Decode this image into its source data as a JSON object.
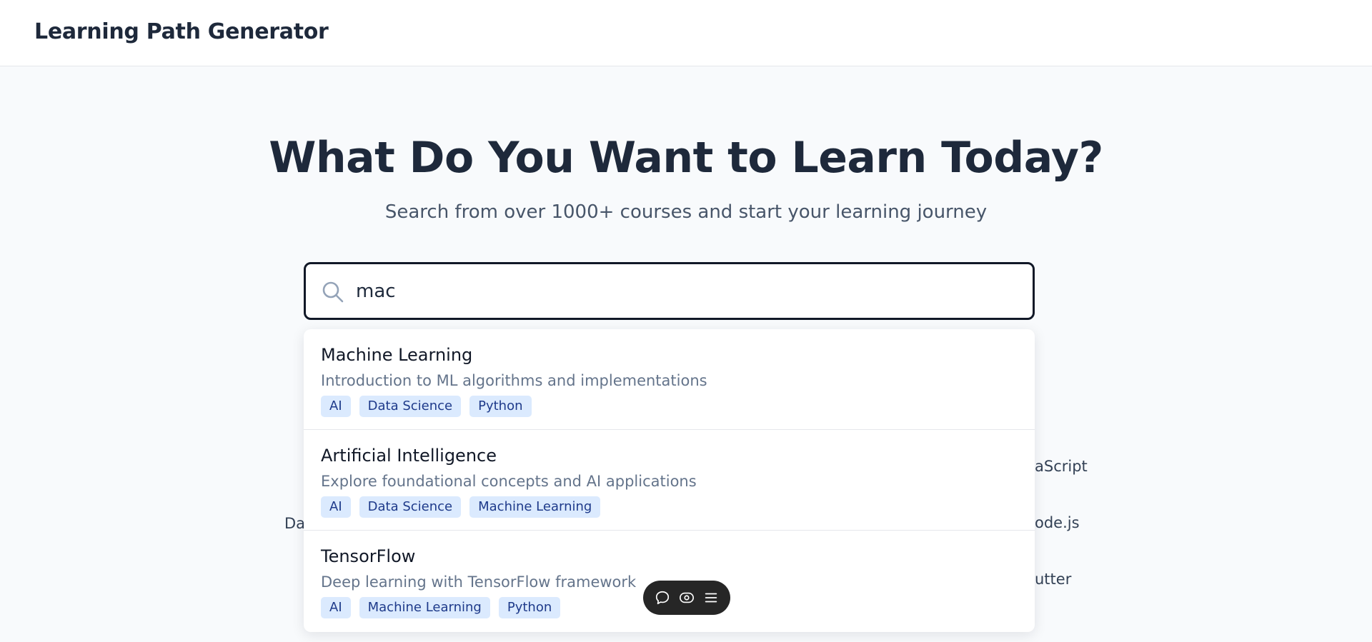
{
  "header": {
    "brand": "Learning Path Generator"
  },
  "hero": {
    "title": "What Do You Want to Learn Today?",
    "subtitle": "Search from over 1000+ courses and start your learning journey"
  },
  "search": {
    "value": "mac",
    "icon": "search-icon"
  },
  "background_items": {
    "left": [
      "Da"
    ],
    "right": [
      "aScript",
      "ode.js",
      "utter"
    ]
  },
  "results": [
    {
      "title": "Machine Learning",
      "description": "Introduction to ML algorithms and implementations",
      "tags": [
        "AI",
        "Data Science",
        "Python"
      ]
    },
    {
      "title": "Artificial Intelligence",
      "description": "Explore foundational concepts and AI applications",
      "tags": [
        "AI",
        "Data Science",
        "Machine Learning"
      ]
    },
    {
      "title": "TensorFlow",
      "description": "Deep learning with TensorFlow framework",
      "tags": [
        "AI",
        "Machine Learning",
        "Python"
      ]
    }
  ],
  "toolbar": {
    "icons": [
      "comment-icon",
      "eye-icon",
      "menu-icon"
    ]
  },
  "colors": {
    "accent_tag_bg": "#dbeafe",
    "accent_tag_text": "#1e3a8a",
    "toolbar_bg": "#262626"
  }
}
